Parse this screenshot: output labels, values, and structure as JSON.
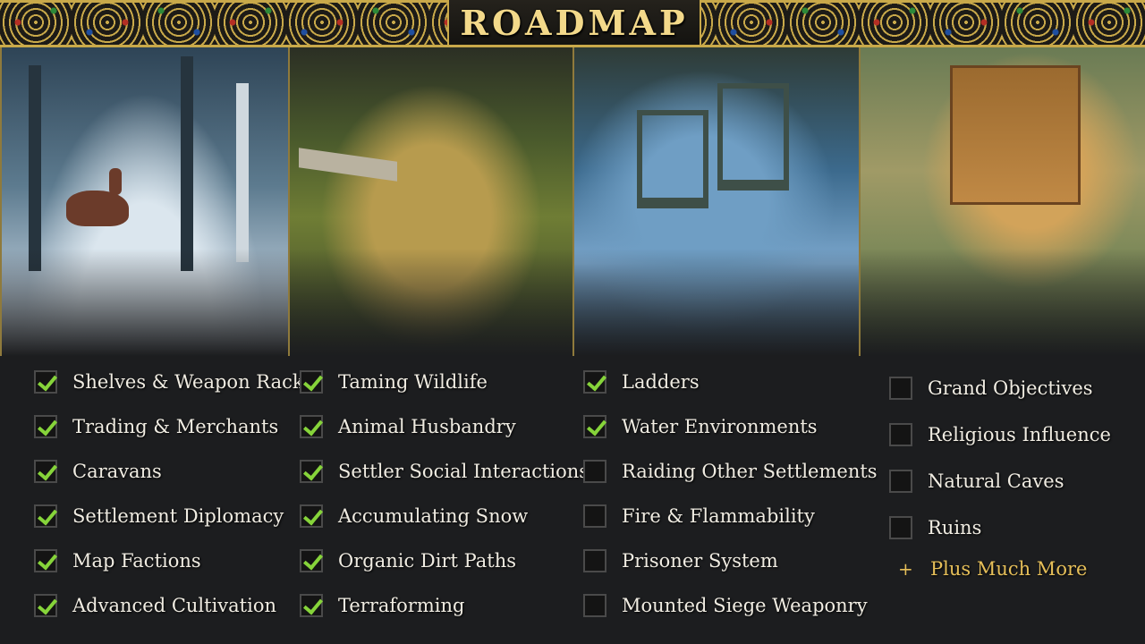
{
  "header": {
    "title": "ROADMAP"
  },
  "columns": [
    {
      "items": [
        {
          "label": "Shelves & Weapon Racks",
          "checked": true
        },
        {
          "label": "Trading & Merchants",
          "checked": true
        },
        {
          "label": "Caravans",
          "checked": true
        },
        {
          "label": "Settlement Diplomacy",
          "checked": true
        },
        {
          "label": "Map Factions",
          "checked": true
        },
        {
          "label": "Advanced Cultivation",
          "checked": true
        }
      ]
    },
    {
      "items": [
        {
          "label": "Taming Wildlife",
          "checked": true
        },
        {
          "label": "Animal Husbandry",
          "checked": true
        },
        {
          "label": "Settler Social Interactions",
          "checked": true
        },
        {
          "label": "Accumulating Snow",
          "checked": true
        },
        {
          "label": "Organic Dirt Paths",
          "checked": true
        },
        {
          "label": "Terraforming",
          "checked": true
        }
      ]
    },
    {
      "items": [
        {
          "label": "Ladders",
          "checked": true
        },
        {
          "label": "Water Environments",
          "checked": true
        },
        {
          "label": "Raiding Other Settlements",
          "checked": false
        },
        {
          "label": "Fire & Flammability",
          "checked": false
        },
        {
          "label": "Prisoner System",
          "checked": false
        },
        {
          "label": "Mounted Siege Weaponry",
          "checked": false
        }
      ]
    },
    {
      "items": [
        {
          "label": "Grand Objectives",
          "checked": false
        },
        {
          "label": "Religious Influence",
          "checked": false
        },
        {
          "label": "Natural Caves",
          "checked": false
        },
        {
          "label": "Ruins",
          "checked": false
        }
      ]
    }
  ],
  "more": {
    "icon": "+",
    "label": "Plus Much More"
  },
  "colors": {
    "accent": "#e6bf59",
    "check": "#86d43a",
    "gold_border": "#c9a94a"
  },
  "screenshots": [
    {
      "name": "winter-forest-deer"
    },
    {
      "name": "garden-settlers"
    },
    {
      "name": "siege-battle"
    },
    {
      "name": "wooden-fort"
    }
  ]
}
